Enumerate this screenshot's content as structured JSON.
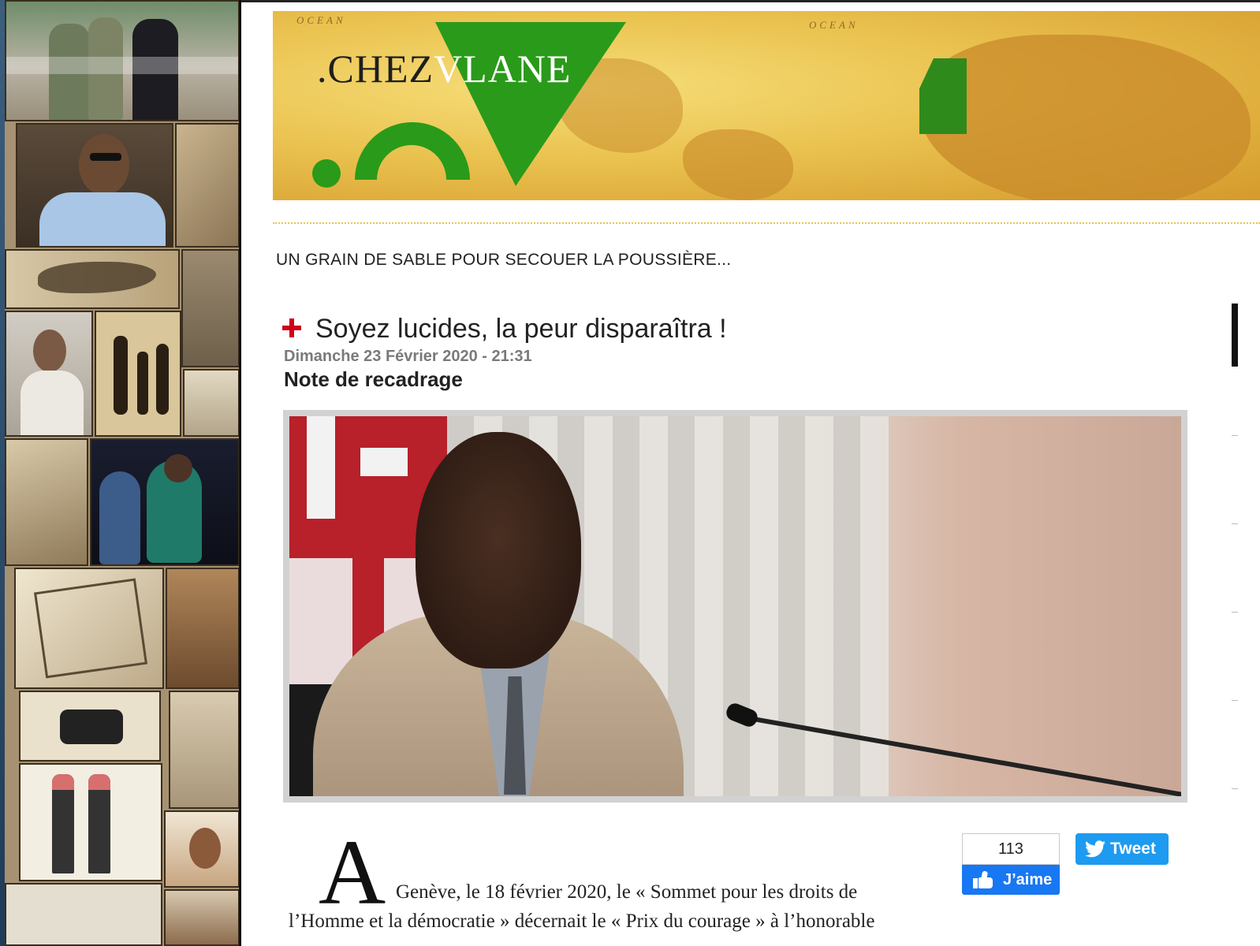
{
  "header": {
    "brand_left": ".CHEZ",
    "brand_right": "VLANE",
    "ocean_labels": [
      "OCEAN",
      "OCEAN"
    ]
  },
  "tagline": "UN GRAIN DE SABLE POUR SECOUER LA POUSSIÈRE...",
  "article": {
    "title": "Soyez lucides, la peur disparaîtra !",
    "date": "Dimanche 23 Février 2020 - 21:31",
    "subtitle": "Note de recadrage",
    "dropcap": "A",
    "body_line_1": "Genève, le 18 février 2020, le « Sommet pour les droits de",
    "body_line_2": "l’Homme et la démocratie » décernait le « Prix du courage » à l’honorable"
  },
  "social": {
    "like_count": "113",
    "like_label": "J’aime",
    "tweet_label": "Tweet"
  },
  "colors": {
    "accent_red": "#d0021b",
    "brand_green": "#2a9a1a",
    "facebook_blue": "#1877f2",
    "twitter_blue": "#1d9bf0",
    "banner_gold": "#eac24f"
  },
  "icons": [
    "plus-cross-icon",
    "thumbs-up-icon",
    "twitter-bird-icon",
    "brand-logo-icon"
  ]
}
